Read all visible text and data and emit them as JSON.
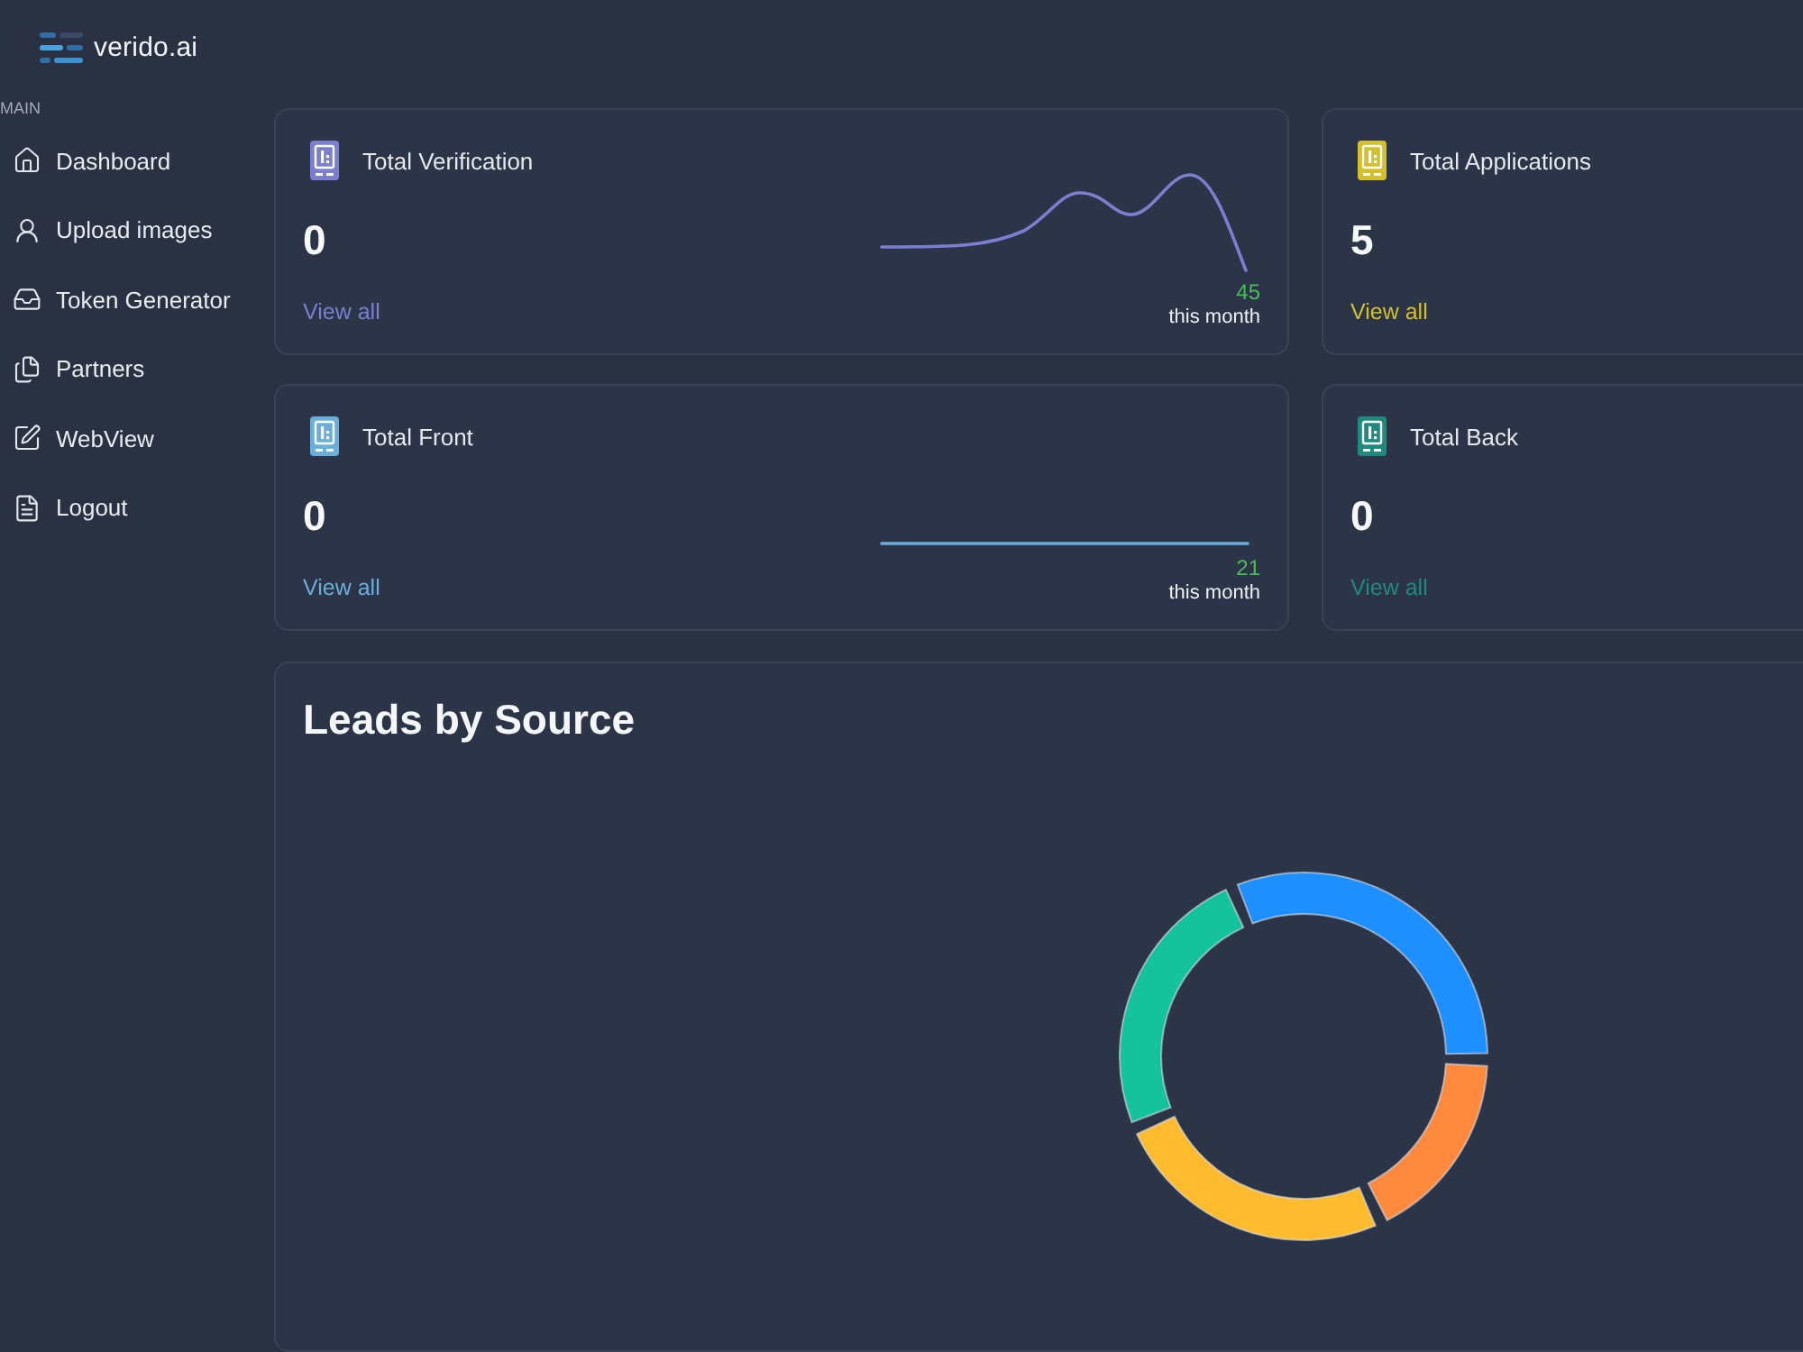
{
  "brand": {
    "name": "verido.ai"
  },
  "sidebar": {
    "section": "MAIN",
    "items": [
      {
        "label": "Dashboard"
      },
      {
        "label": "Upload images"
      },
      {
        "label": "Token Generator"
      },
      {
        "label": "Partners"
      },
      {
        "label": "WebView"
      },
      {
        "label": "Logout"
      }
    ]
  },
  "cards": [
    {
      "kind": "curve",
      "title": "Total Verification",
      "value": "0",
      "link": "View all",
      "color": "#7a7fd0",
      "trend_value": "45",
      "trend_label": "this month"
    },
    {
      "kind": "plain",
      "title": "Total Applications",
      "value": "5",
      "link": "View all",
      "color": "#d4bf2c"
    },
    {
      "kind": "flat",
      "title": "Total Front",
      "value": "0",
      "link": "View all",
      "color": "#6aaedb",
      "trend_value": "21",
      "trend_label": "this month"
    },
    {
      "kind": "plain",
      "title": "Total Back",
      "value": "0",
      "link": "View all",
      "color": "#1f8a80"
    }
  ],
  "leads": {
    "title": "Leads by Source"
  }
}
